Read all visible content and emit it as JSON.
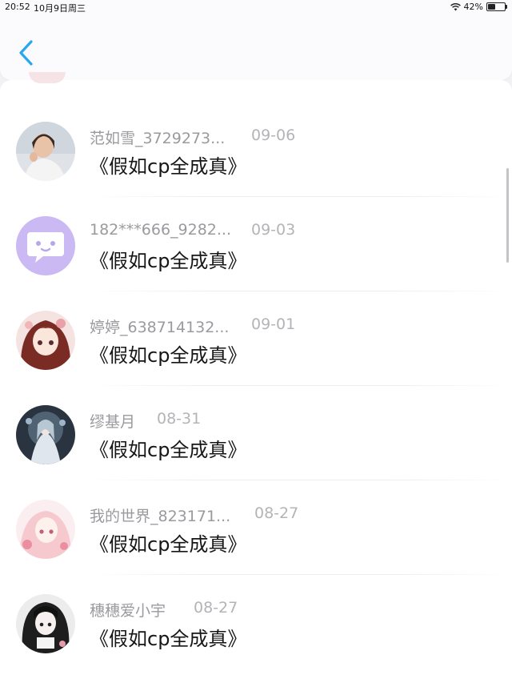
{
  "status_bar": {
    "time": "20:52",
    "date": "10月9日周三",
    "battery": "42%",
    "battery_level": 0.42
  },
  "nav": {
    "back_icon": "chevron-left-icon",
    "accent": "#2aa6f0"
  },
  "items": [
    {
      "username": "范如雪_3729273...",
      "date": "09-06",
      "title": "《假如cp全成真》"
    },
    {
      "username": "182***666_9282...",
      "date": "09-03",
      "title": "《假如cp全成真》"
    },
    {
      "username": "婷婷_638714132...",
      "date": "09-01",
      "title": "《假如cp全成真》"
    },
    {
      "username": "缪基月",
      "date": "08-31",
      "title": "《假如cp全成真》"
    },
    {
      "username": "我的世界_823171...",
      "date": "08-27",
      "title": "《假如cp全成真》"
    },
    {
      "username": "穗穗爱小宇",
      "date": "08-27",
      "title": "《假如cp全成真》"
    }
  ]
}
